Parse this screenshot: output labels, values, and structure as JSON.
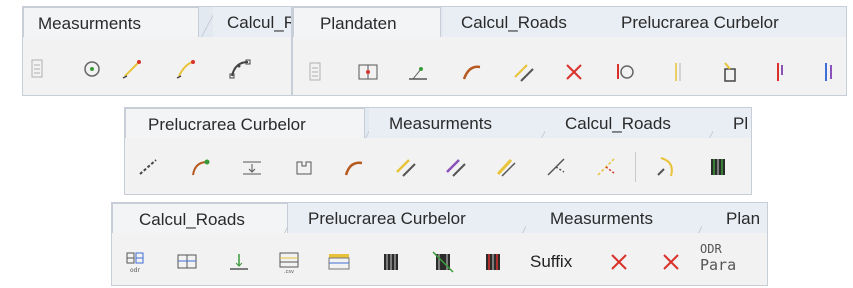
{
  "panel1": {
    "tabs": [
      {
        "label": "Measurments",
        "active": true
      },
      {
        "label": "Calcul_R",
        "active": false
      }
    ],
    "icons": [
      "blank-sheet-icon",
      "circle-point-icon",
      "pen-point-icon",
      "pen-curve-icon",
      "curve-nodes-icon"
    ]
  },
  "panel2": {
    "tabs": [
      {
        "label": "Plandaten",
        "active": true
      },
      {
        "label": "Calcul_Roads",
        "active": false
      },
      {
        "label": "Prelucrarea Curbelor",
        "active": false
      }
    ],
    "icons": [
      "blank-sheet-icon",
      "frame-point-icon",
      "axis-point-icon",
      "curve-icon",
      "double-diagonal-icon",
      "red-cross-icon",
      "info-circle-icon",
      "vertical-line-icon",
      "pen-holder-icon",
      "red-tick-icon",
      "blue-purple-bars-icon"
    ]
  },
  "panel3": {
    "tabs": [
      {
        "label": "Prelucrarea Curbelor",
        "active": true
      },
      {
        "label": "Measurments",
        "active": false
      },
      {
        "label": "Calcul_Roads",
        "active": false
      },
      {
        "label": "Pl",
        "active": false
      }
    ],
    "icons": [
      "dashed-diagonal-icon",
      "green-curve-icon",
      "level-mark-icon",
      "bracket-icon",
      "curve-icon",
      "yellow-double-diagonal-icon",
      "purple-double-diagonal-icon",
      "yellow-diagonal-icon",
      "branch-icon",
      "dashed-branch-icon",
      "curve-arrow-icon",
      "striped-block-icon"
    ]
  },
  "panel4": {
    "tabs": [
      {
        "label": "Calcul_Roads",
        "active": true
      },
      {
        "label": "Prelucrarea Curbelor",
        "active": false
      },
      {
        "label": "Measurments",
        "active": false
      },
      {
        "label": "Plan",
        "active": false
      }
    ],
    "icons": [
      "table-odr-icon",
      "table-icon",
      "axis-arrow-icon",
      "table-lines-icon",
      "yellow-table-icon",
      "striped-block-icon",
      "crossed-block-icon",
      "striped-block-red-icon"
    ],
    "suffix_label": "Suffix",
    "odr_line1": "ODR",
    "odr_line2": "Para",
    "red_icons": [
      "red-x-icon",
      "red-x-icon"
    ]
  },
  "colors": {
    "yellow": "#e8c33a",
    "red": "#d9322b",
    "purple": "#8a52b8",
    "blue": "#3d6fd6",
    "green": "#3a9a3a",
    "gray": "#8b8b8b",
    "dark": "#444444"
  }
}
